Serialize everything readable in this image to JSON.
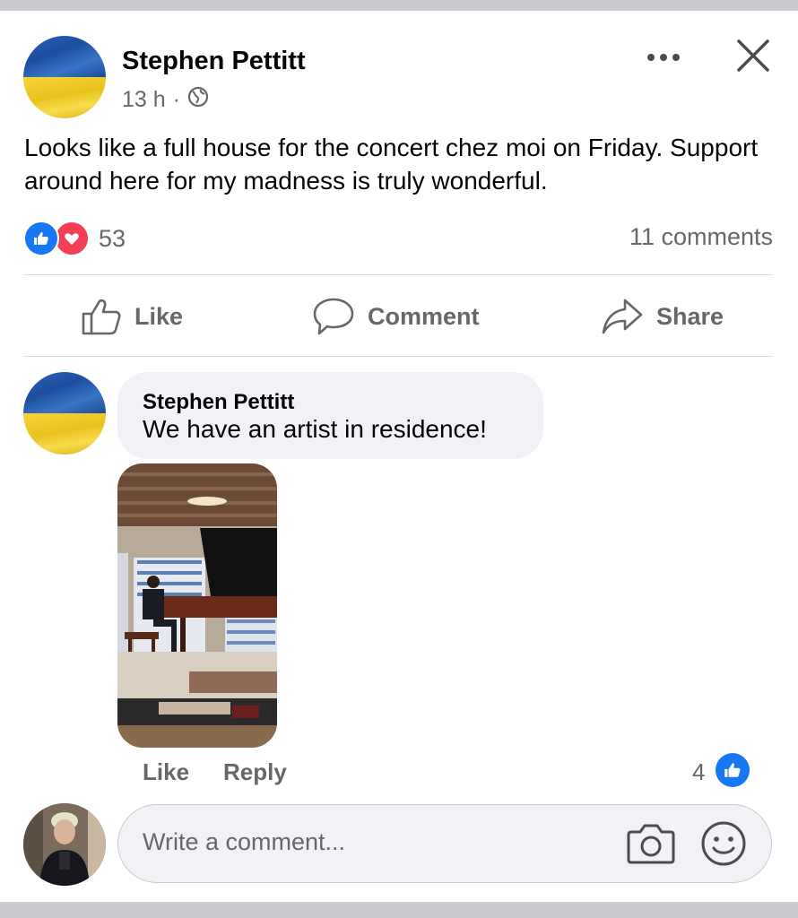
{
  "post": {
    "author": "Stephen Pettitt",
    "time": "13 h",
    "separator": "·",
    "visibility_icon": "globe-icon",
    "text": "Looks like a full house for the concert chez moi on Friday. Support around here for my madness is truly wonderful.",
    "reaction_icons": [
      "like-reaction-icon",
      "love-reaction-icon"
    ],
    "reaction_count": "53",
    "comments_count": "11 comments"
  },
  "actions": {
    "like": "Like",
    "comment": "Comment",
    "share": "Share"
  },
  "comment": {
    "author": "Stephen Pettitt",
    "text": "We have an artist in residence!",
    "like_label": "Like",
    "reply_label": "Reply",
    "like_count": "4"
  },
  "composer": {
    "placeholder": "Write a comment..."
  },
  "colors": {
    "accent": "#1877f2",
    "love": "#f33e58",
    "secondary_text": "#65676b",
    "bubble": "#f0f2f5"
  }
}
